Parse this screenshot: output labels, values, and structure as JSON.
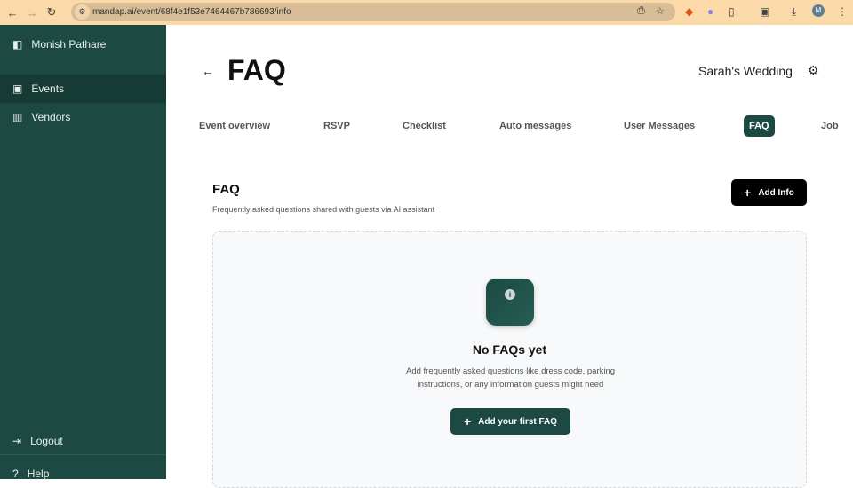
{
  "browser": {
    "url": "mandap.ai/event/68f4e1f53e7464467b786693/info",
    "avatar": "M"
  },
  "sidebar": {
    "user": "Monish Pathare",
    "items": [
      {
        "label": "Events"
      },
      {
        "label": "Vendors"
      }
    ],
    "logout": "Logout",
    "help": "Help"
  },
  "header": {
    "title": "FAQ",
    "event_name": "Sarah's Wedding"
  },
  "tabs": [
    {
      "label": "Event overview"
    },
    {
      "label": "RSVP"
    },
    {
      "label": "Checklist"
    },
    {
      "label": "Auto messages"
    },
    {
      "label": "User Messages"
    },
    {
      "label": "FAQ"
    },
    {
      "label": "Job"
    }
  ],
  "section": {
    "title": "FAQ",
    "subtitle": "Frequently asked questions shared with guests via AI assistant",
    "add_button": "Add Info"
  },
  "empty": {
    "title": "No FAQs yet",
    "description": "Add frequently asked questions like dress code, parking instructions, or any information guests might need",
    "button": "Add your first FAQ"
  }
}
